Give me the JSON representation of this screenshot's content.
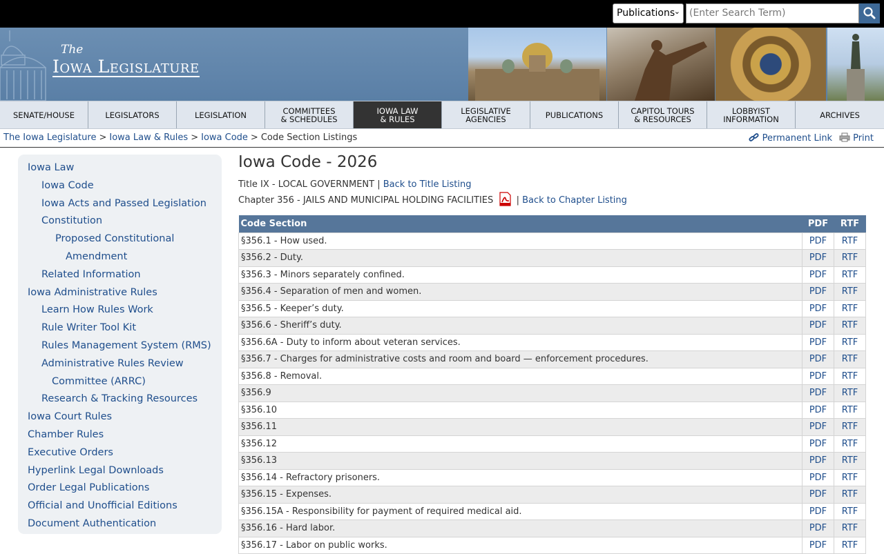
{
  "search": {
    "select_value": "Publications",
    "placeholder": "(Enter Search Term)"
  },
  "logo": {
    "the": "The",
    "name": "Iowa Legislature"
  },
  "nav": [
    {
      "label": "SENATE/HOUSE"
    },
    {
      "label": "LEGISLATORS"
    },
    {
      "label": "LEGISLATION"
    },
    {
      "label": "COMMITTEES\n& SCHEDULES"
    },
    {
      "label": "IOWA LAW\n& RULES",
      "active": true
    },
    {
      "label": "LEGISLATIVE\nAGENCIES"
    },
    {
      "label": "PUBLICATIONS"
    },
    {
      "label": "CAPITOL TOURS\n& RESOURCES"
    },
    {
      "label": "LOBBYIST\nINFORMATION"
    },
    {
      "label": "ARCHIVES"
    }
  ],
  "breadcrumb": {
    "items": [
      "The Iowa Legislature",
      "Iowa Law & Rules",
      "Iowa Code"
    ],
    "current": "Code Section Listings",
    "separator": ">",
    "permanent_link": "Permanent Link",
    "print": "Print"
  },
  "sidebar": {
    "items": [
      {
        "label": "Iowa Law",
        "indent": 0
      },
      {
        "label": "Iowa Code",
        "indent": 1
      },
      {
        "label": "Iowa Acts and Passed Legislation",
        "indent": 1
      },
      {
        "label": "Constitution",
        "indent": 1
      },
      {
        "label": "Proposed Constitutional",
        "indent": 2
      },
      {
        "label": "Amendment",
        "indent": 3
      },
      {
        "label": "Related Information",
        "indent": 1
      },
      {
        "label": "Iowa Administrative Rules",
        "indent": 0
      },
      {
        "label": "Learn How Rules Work",
        "indent": 1
      },
      {
        "label": "Rule Writer Tool Kit",
        "indent": 1
      },
      {
        "label": "Rules Management System (RMS)",
        "indent": 1
      },
      {
        "label": "Administrative Rules Review",
        "indent": 1
      },
      {
        "label": "Committee (ARRC)",
        "indent": 4
      },
      {
        "label": "Research & Tracking Resources",
        "indent": 1
      },
      {
        "label": "Iowa Court Rules",
        "indent": 0
      },
      {
        "label": "Chamber Rules",
        "indent": 0
      },
      {
        "label": "Executive Orders",
        "indent": 0
      },
      {
        "label": "Hyperlink Legal Downloads",
        "indent": 0
      },
      {
        "label": "Order Legal Publications",
        "indent": 0
      },
      {
        "label": "Official and Unofficial Editions",
        "indent": 0
      },
      {
        "label": "Document Authentication",
        "indent": 0
      }
    ]
  },
  "main": {
    "title": "Iowa Code - 2026",
    "title_line": "Title IX - LOCAL GOVERNMENT |",
    "back_title": "Back to Title Listing",
    "chapter_line": "Chapter 356 - JAILS AND MUNICIPAL HOLDING FACILITIES",
    "chapter_sep": "|",
    "back_chapter": "Back to Chapter Listing",
    "table": {
      "headers": [
        "Code Section",
        "PDF",
        "RTF"
      ],
      "pdf_label": "PDF",
      "rtf_label": "RTF",
      "rows": [
        "§356.1 - How used.",
        "§356.2 - Duty.",
        "§356.3 - Minors separately confined.",
        "§356.4 - Separation of men and women.",
        "§356.5 - Keeper’s duty.",
        "§356.6 - Sheriff’s duty.",
        "§356.6A - Duty to inform about veteran services.",
        "§356.7 - Charges for administrative costs and room and board — enforcement procedures.",
        "§356.8 - Removal.",
        "§356.9",
        "§356.10",
        "§356.11",
        "§356.12",
        "§356.13",
        "§356.14 - Refractory prisoners.",
        "§356.15 - Expenses.",
        "§356.15A - Responsibility for payment of required medical aid.",
        "§356.16 - Hard labor.",
        "§356.17 - Labor on public works."
      ]
    }
  },
  "colors": {
    "link": "#1f4e8c",
    "header_bar": "#56769a",
    "nav_active": "#333333",
    "banner": "#5a7fa6"
  }
}
